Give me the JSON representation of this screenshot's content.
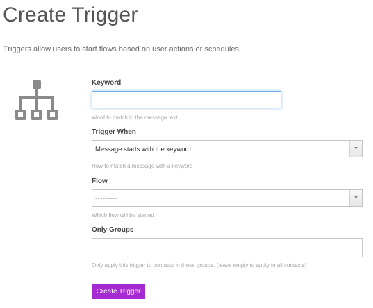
{
  "page": {
    "title": "Create Trigger",
    "description": "Triggers allow users to start flows based on user actions or schedules."
  },
  "icon": {
    "name": "sitemap-icon"
  },
  "form": {
    "keyword": {
      "label": "Keyword",
      "value": "",
      "help": "Word to match in the message text"
    },
    "trigger_when": {
      "label": "Trigger When",
      "selected": "Message starts with the keyword",
      "help": "How to match a message with a keyword"
    },
    "flow": {
      "label": "Flow",
      "selected": "---------",
      "help": "Which flow will be started"
    },
    "only_groups": {
      "label": "Only Groups",
      "value": "",
      "help": "Only apply this trigger to contacts in these groups. (leave empty to apply to all contacts)"
    },
    "submit_label": "Create Trigger"
  },
  "colors": {
    "accent": "#a52ad1",
    "icon": "#8a8a8a",
    "focus": "#6fb1e6"
  }
}
